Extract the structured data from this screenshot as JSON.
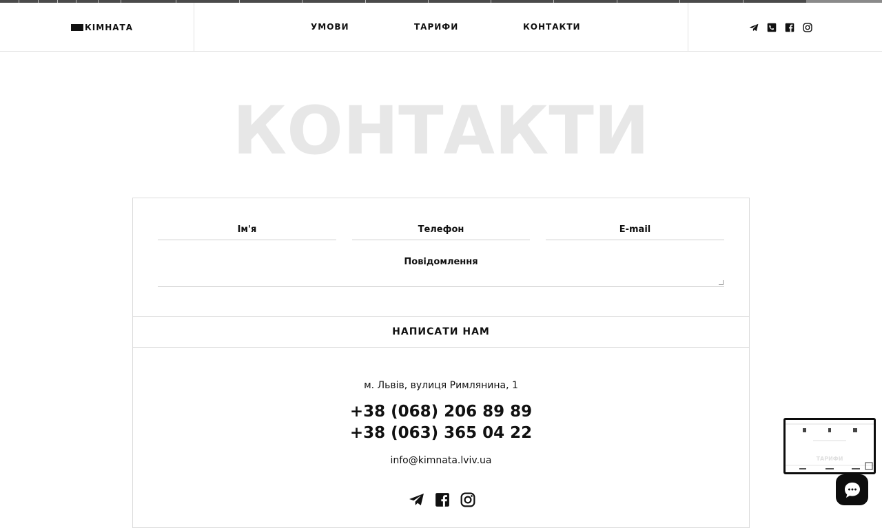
{
  "header": {
    "logo_text": "КІМНАТА",
    "nav": [
      {
        "label": "УМОВИ"
      },
      {
        "label": "ТАРИФИ"
      },
      {
        "label": "КОНТАКТИ"
      }
    ],
    "social_icons": [
      "telegram-icon",
      "viber-icon",
      "facebook-icon",
      "instagram-icon"
    ]
  },
  "hero": {
    "title": "КОНТАКТИ"
  },
  "form": {
    "name_label": "Ім'я",
    "phone_label": "Телефон",
    "email_label": "E-mail",
    "message_label": "Повідомлення",
    "submit_label": "НАПИСАТИ НАМ"
  },
  "contacts": {
    "address": "м. Львів, вулиця Римлянина, 1",
    "phone_1": "+38 (068) 206 89 89",
    "phone_2": "+38 (063) 365 04 22",
    "email": "info@kimnata.lviv.ua",
    "social_icons": [
      "telegram-icon",
      "facebook-icon",
      "instagram-icon"
    ]
  },
  "preview": {
    "title": "ТАРИФИ"
  },
  "colors": {
    "text": "#111111",
    "hero": "#e7e7e7",
    "border": "#dcdcdc",
    "chat_bg": "#0d0d0d"
  }
}
